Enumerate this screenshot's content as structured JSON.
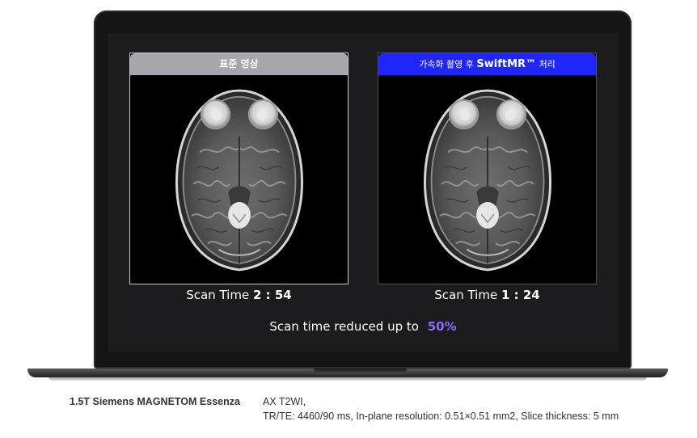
{
  "panels": {
    "standard": {
      "title": "표준 영상",
      "scan_label": "Scan Time",
      "scan_value": "2 : 54"
    },
    "swift": {
      "title_prefix": "가속화 촬영 후",
      "title_brand": "SwiftMR™",
      "title_suffix": "처리",
      "scan_label": "Scan Time",
      "scan_value": "1 : 24"
    }
  },
  "summary": {
    "text": "Scan time reduced up to",
    "percent": "50%"
  },
  "specs": {
    "device": "1.5T Siemens MAGNETOM Essenza",
    "sequence": "AX T2WI,",
    "details": "TR/TE: 4460/90 ms, In-plane resolution: 0.51×0.51 mm2, Slice thickness: 5 mm"
  },
  "colors": {
    "accent_blue": "#1f26f5",
    "panel_gray": "#a8a6ad",
    "highlight_purple": "#8f6cf7",
    "screen_bg": "#1c1c1e"
  }
}
